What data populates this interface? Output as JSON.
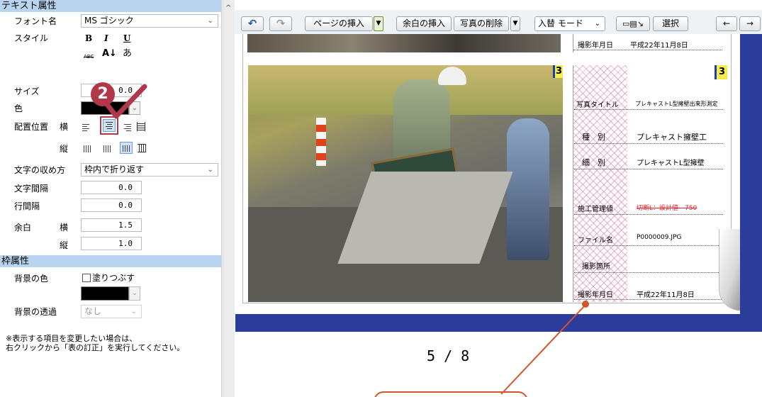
{
  "panel": {
    "text_props_header": "テキスト属性",
    "font_label": "フォント名",
    "font_value": "MS ゴシック",
    "style_label": "スタイル",
    "style_bold": "B",
    "style_italic": "I",
    "style_underline": "U",
    "style_abc": "ABC",
    "style_aa": "A↓",
    "style_a": "あ",
    "size_label": "サイズ",
    "size_value": "0.0",
    "color_label": "色",
    "align_label": "配置位置",
    "horiz_label": "横",
    "vert_label": "縦",
    "wrap_label": "文字の収め方",
    "wrap_value": "枠内で折り返す",
    "char_spacing_label": "文字間隔",
    "char_spacing_value": "0.0",
    "line_spacing_label": "行間隔",
    "line_spacing_value": "0.0",
    "margin_label": "余白",
    "margin_h_value": "1.5",
    "margin_v_value": "1.0",
    "frame_props_header": "枠属性",
    "bg_color_label": "背景の色",
    "fill_label": "塗りつぶす",
    "bg_transparency_label": "背景の透過",
    "transparency_value": "なし",
    "note_line1": "※表示する項目を変更したい場合は、",
    "note_line2": "右クリックから「表の訂正」を実行してください。",
    "callout_number": "2"
  },
  "toolbar": {
    "insert_page": "ページの挿入",
    "insert_margin": "余白の挿入",
    "delete_photo": "写真の削除",
    "replace_mode": "入替 モード",
    "select": "選択",
    "left_arrow": "←",
    "right_arrow": "→"
  },
  "photo_page": {
    "prev_date_label": "撮影年月日",
    "prev_date_value": "平成22年11月8日",
    "photo_number": "3",
    "info_number": "3",
    "rows": [
      {
        "label": "写真タイトル",
        "value": "プレキャストL型擁壁出来形測定"
      },
      {
        "label": "種　別",
        "value": "プレキャスト擁壁工"
      },
      {
        "label": "細　別",
        "value": "プレキャストL型擁壁"
      },
      {
        "label": "施工管理値",
        "value": "切断L：設計値　750"
      },
      {
        "label": "ファイル名",
        "value": "P0000009.JPG"
      },
      {
        "label": "撮影箇所",
        "value": ""
      },
      {
        "label": "撮影年月日",
        "value": "平成22年11月8日"
      }
    ],
    "page_indicator": "5 / 8"
  },
  "colors": {
    "section_header": "#b8d4ee",
    "callout": "#b0384a",
    "annotation_line": "#d0572c",
    "page_frame": "#2b3c9a",
    "hatch_pink": "#e07ab0"
  }
}
